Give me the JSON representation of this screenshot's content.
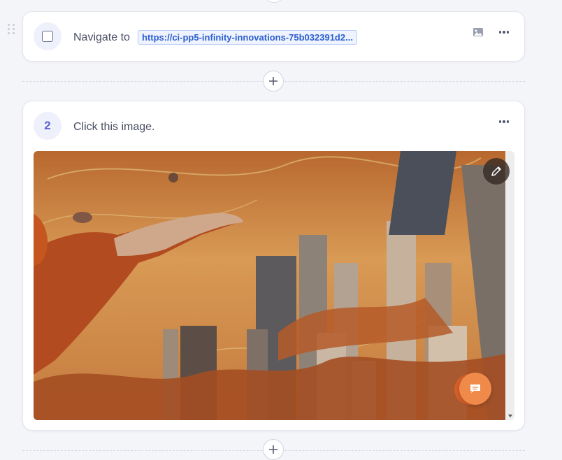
{
  "steps": [
    {
      "type": "navigate",
      "text": "Navigate to",
      "url": "https://ci-pp5-infinity-innovations-75b032391d2..."
    },
    {
      "number": "2",
      "text": "Click this image."
    }
  ],
  "icons": {
    "checkbox": "checkbox-icon",
    "image": "image-icon",
    "more": "more-options-icon",
    "add": "plus-icon",
    "edit": "pencil-icon",
    "chat": "chat-icon"
  },
  "colors": {
    "accent": "#5b63d3",
    "url_text": "#2c5fd0",
    "chat_button": "#f08a4b"
  }
}
